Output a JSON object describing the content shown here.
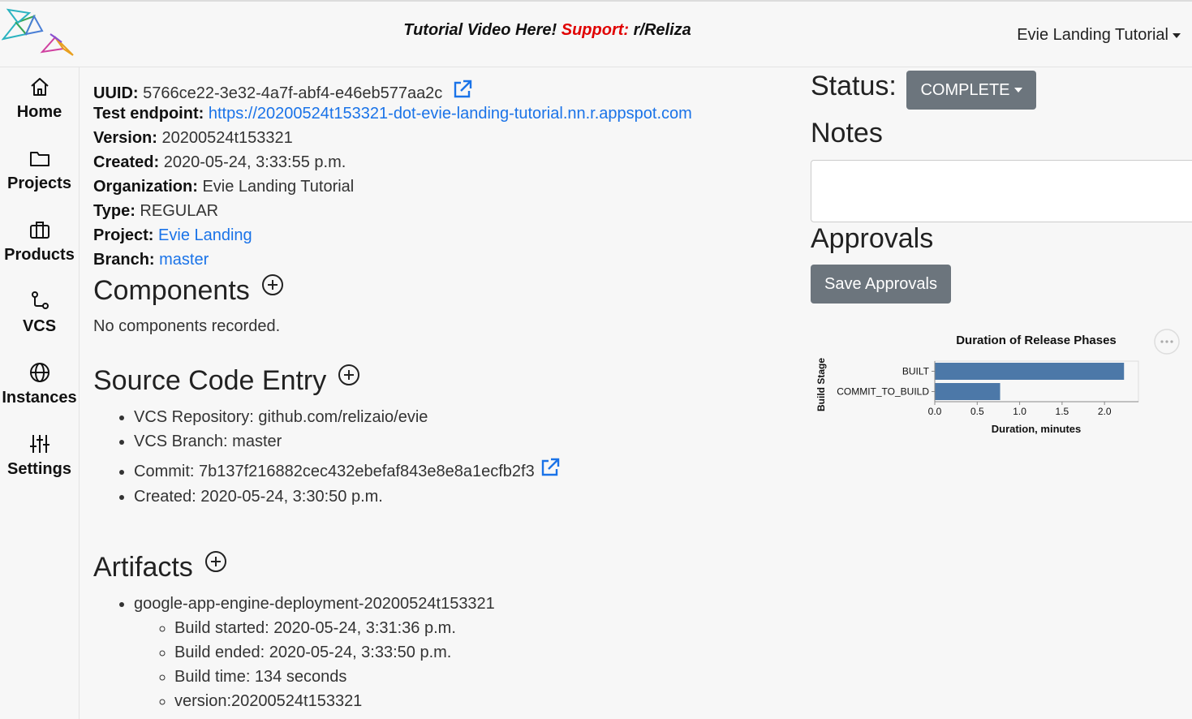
{
  "header": {
    "banner_part1": "Tutorial Video Here!",
    "banner_support": "Support:",
    "banner_part2": "r/Reliza",
    "org_menu": "Evie Landing Tutorial"
  },
  "sidebar": {
    "items": [
      {
        "label": "Home",
        "icon": "home-icon"
      },
      {
        "label": "Projects",
        "icon": "folder-icon"
      },
      {
        "label": "Products",
        "icon": "briefcase-icon"
      },
      {
        "label": "VCS",
        "icon": "branch-icon"
      },
      {
        "label": "Instances",
        "icon": "globe-icon"
      },
      {
        "label": "Settings",
        "icon": "sliders-icon"
      }
    ]
  },
  "release": {
    "uuid_label": "UUID:",
    "uuid": "5766ce22-3e32-4a7f-abf4-e46eb577aa2c",
    "endpoint_label": "Test endpoint:",
    "endpoint": "https://20200524t153321-dot-evie-landing-tutorial.nn.r.appspot.com",
    "version_label": "Version:",
    "version": "20200524t153321",
    "created_label": "Created:",
    "created": "2020-05-24, 3:33:55 p.m.",
    "org_label": "Organization:",
    "org": "Evie Landing Tutorial",
    "type_label": "Type:",
    "type": "REGULAR",
    "project_label": "Project:",
    "project": "Evie Landing",
    "branch_label": "Branch:",
    "branch": "master"
  },
  "components": {
    "title": "Components",
    "empty": "No components recorded."
  },
  "source_code": {
    "title": "Source Code Entry",
    "items": [
      "VCS Repository: github.com/relizaio/evie",
      "VCS Branch: master",
      "Commit: 7b137f216882cec432ebefaf843e8e8a1ecfb2f3",
      "Created: 2020-05-24, 3:30:50 p.m."
    ]
  },
  "artifacts": {
    "title": "Artifacts",
    "name": "google-app-engine-deployment-20200524t153321",
    "details": [
      "Build started: 2020-05-24, 3:31:36 p.m.",
      "Build ended: 2020-05-24, 3:33:50 p.m.",
      "Build time: 134 seconds",
      "version:20200524t153321"
    ]
  },
  "status": {
    "label": "Status:",
    "value": "COMPLETE"
  },
  "notes": {
    "label": "Notes",
    "value": ""
  },
  "approvals": {
    "label": "Approvals",
    "save_label": "Save Approvals"
  },
  "colors": {
    "link": "#1a73e8",
    "button": "#6c757d",
    "support": "#e00000",
    "bar": "#4c78a8"
  },
  "chart_data": {
    "type": "bar",
    "orientation": "horizontal",
    "title": "Duration of Release Phases",
    "xlabel": "Duration, minutes",
    "ylabel": "Build Stage",
    "categories": [
      "BUILT",
      "COMMIT_TO_BUILD"
    ],
    "values": [
      2.23,
      0.77
    ],
    "xlim": [
      0,
      2.4
    ],
    "xticks": [
      "0.0",
      "0.5",
      "1.0",
      "1.5",
      "2.0"
    ],
    "grid": false
  }
}
